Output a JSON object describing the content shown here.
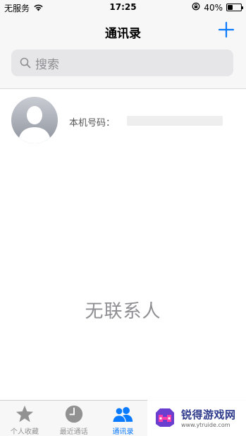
{
  "status_bar": {
    "carrier": "无服务",
    "time": "17:25",
    "battery": "40%",
    "battery_level": 0.4,
    "icons": [
      "wifi-icon",
      "rotation-lock-icon",
      "battery-icon"
    ]
  },
  "header": {
    "title": "通讯录",
    "add_icon": "plus-icon"
  },
  "search": {
    "placeholder": "搜索",
    "icon": "search-icon"
  },
  "my_card": {
    "number_label": "本机号码："
  },
  "empty_state": {
    "text": "无联系人"
  },
  "tabbar": {
    "tabs": [
      {
        "label": "个人收藏",
        "icon": "star-icon",
        "active": false
      },
      {
        "label": "最近通话",
        "icon": "clock-icon",
        "active": false
      },
      {
        "label": "通讯录",
        "icon": "contacts-icon",
        "active": true
      }
    ]
  },
  "watermark": {
    "brand": "锐得游戏网",
    "url": "www.ytruide.com"
  },
  "colors": {
    "accent": "#0a7aff",
    "inactive": "#929292",
    "bar_bg": "#f7f7f7"
  }
}
